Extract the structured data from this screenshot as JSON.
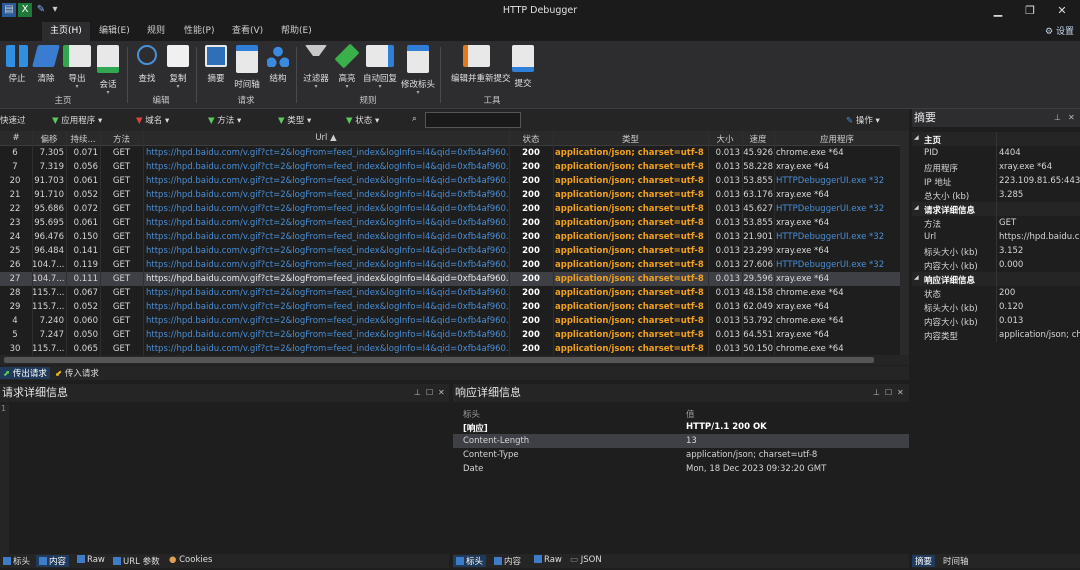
{
  "window": {
    "title": "HTTP Debugger",
    "settings": "设置"
  },
  "menu": [
    "主页(H)",
    "编辑(E)",
    "规则",
    "性能(P)",
    "查看(V)",
    "帮助(E)"
  ],
  "ribbon": {
    "buttons": [
      "停止",
      "清除",
      "导出",
      "会话",
      "查找",
      "复制",
      "摘要",
      "时间轴",
      "结构",
      "过滤器",
      "高亮",
      "自动回复",
      "修改标头",
      "编辑并重新提交",
      "提交"
    ],
    "groups": [
      "主页",
      "编辑",
      "请求",
      "规则",
      "工具"
    ]
  },
  "filterbar": {
    "quick": "快速过",
    "app": "应用程序",
    "domain": "域名",
    "method": "方法",
    "type": "类型",
    "status": "状态",
    "ops": "操作"
  },
  "grid": {
    "columns": [
      "#",
      "偏移",
      "持续...",
      "方法",
      "Url",
      "状态",
      "类型",
      "大小",
      "速度",
      "应用程序"
    ],
    "rows": [
      [
        "6",
        "7.305",
        "0.071",
        "GET",
        "https://hpd.baidu.com/v.gif?ct=2&logFrom=feed_index&logInfo=l4&qid=0xfb4af960...",
        "200",
        "application/json; charset=utf-8",
        "0.013",
        "45.926",
        "chrome.exe *64"
      ],
      [
        "7",
        "7.319",
        "0.056",
        "GET",
        "https://hpd.baidu.com/v.gif?ct=2&logFrom=feed_index&logInfo=l4&qid=0xfb4af960...",
        "200",
        "application/json; charset=utf-8",
        "0.013",
        "58.228",
        "xray.exe *64"
      ],
      [
        "20",
        "91.703",
        "0.061",
        "GET",
        "https://hpd.baidu.com/v.gif?ct=2&logFrom=feed_index&logInfo=l4&qid=0xfb4af960...",
        "200",
        "application/json; charset=utf-8",
        "0.013",
        "53.855",
        "HTTPDebuggerUI.exe *32"
      ],
      [
        "21",
        "91.710",
        "0.052",
        "GET",
        "https://hpd.baidu.com/v.gif?ct=2&logFrom=feed_index&logInfo=l4&qid=0xfb4af960...",
        "200",
        "application/json; charset=utf-8",
        "0.013",
        "63.176",
        "xray.exe *64"
      ],
      [
        "22",
        "95.686",
        "0.072",
        "GET",
        "https://hpd.baidu.com/v.gif?ct=2&logFrom=feed_index&logInfo=l4&qid=0xfb4af960...",
        "200",
        "application/json; charset=utf-8",
        "0.013",
        "45.627",
        "HTTPDebuggerUI.exe *32"
      ],
      [
        "23",
        "95.695",
        "0.061",
        "GET",
        "https://hpd.baidu.com/v.gif?ct=2&logFrom=feed_index&logInfo=l4&qid=0xfb4af960...",
        "200",
        "application/json; charset=utf-8",
        "0.013",
        "53.855",
        "xray.exe *64"
      ],
      [
        "24",
        "96.476",
        "0.150",
        "GET",
        "https://hpd.baidu.com/v.gif?ct=2&logFrom=feed_index&logInfo=l4&qid=0xfb4af960...",
        "200",
        "application/json; charset=utf-8",
        "0.013",
        "21.901",
        "HTTPDebuggerUI.exe *32"
      ],
      [
        "25",
        "96.484",
        "0.141",
        "GET",
        "https://hpd.baidu.com/v.gif?ct=2&logFrom=feed_index&logInfo=l4&qid=0xfb4af960...",
        "200",
        "application/json; charset=utf-8",
        "0.013",
        "23.299",
        "xray.exe *64"
      ],
      [
        "26",
        "104.7...",
        "0.119",
        "GET",
        "https://hpd.baidu.com/v.gif?ct=2&logFrom=feed_index&logInfo=l4&qid=0xfb4af960...",
        "200",
        "application/json; charset=utf-8",
        "0.013",
        "27.606",
        "HTTPDebuggerUI.exe *32"
      ],
      [
        "27",
        "104.7...",
        "0.111",
        "GET",
        "https://hpd.baidu.com/v.gif?ct=2&logFrom=feed_index&logInfo=l4&qid=0xfb4af960...",
        "200",
        "application/json; charset=utf-8",
        "0.013",
        "29.596",
        "xray.exe *64"
      ],
      [
        "28",
        "115.7...",
        "0.067",
        "GET",
        "https://hpd.baidu.com/v.gif?ct=2&logFrom=feed_index&logInfo=l4&qid=0xfb4af960...",
        "200",
        "application/json; charset=utf-8",
        "0.013",
        "48.158",
        "chrome.exe *64"
      ],
      [
        "29",
        "115.7...",
        "0.052",
        "GET",
        "https://hpd.baidu.com/v.gif?ct=2&logFrom=feed_index&logInfo=l4&qid=0xfb4af960...",
        "200",
        "application/json; charset=utf-8",
        "0.013",
        "62.049",
        "xray.exe *64"
      ],
      [
        "4",
        "7.240",
        "0.060",
        "GET",
        "https://hpd.baidu.com/v.gif?ct=2&logFrom=feed_index&logInfo=l4&qid=0xfb4af960...",
        "200",
        "application/json; charset=utf-8",
        "0.013",
        "53.792",
        "chrome.exe *64"
      ],
      [
        "5",
        "7.247",
        "0.050",
        "GET",
        "https://hpd.baidu.com/v.gif?ct=2&logFrom=feed_index&logInfo=l4&qid=0xfb4af960...",
        "200",
        "application/json; charset=utf-8",
        "0.013",
        "64.551",
        "xray.exe *64"
      ],
      [
        "30",
        "115.7...",
        "0.065",
        "GET",
        "https://hpd.baidu.com/v.gif?ct=2&logFrom=feed_index&logInfo=l4&qid=0xfb4af960...",
        "200",
        "application/json; charset=utf-8",
        "0.013",
        "50.150",
        "chrome.exe *64"
      ]
    ],
    "selected_row": "27"
  },
  "grid_tabs": [
    "传出请求",
    "传入请求"
  ],
  "request_panel": {
    "title": "请求详细信息",
    "line": "1",
    "tabs": [
      "标头",
      "内容",
      "Raw",
      "URL 参数",
      "Cookies"
    ]
  },
  "response_panel": {
    "title": "响应详细信息",
    "headers": [
      "标头",
      "值"
    ],
    "rows": [
      [
        "[响应]",
        "HTTP/1.1 200 OK"
      ],
      [
        "Content-Length",
        "13"
      ],
      [
        "Content-Type",
        "application/json; charset=utf-8"
      ],
      [
        "Date",
        "Mon, 18 Dec 2023 09:32:20 GMT"
      ]
    ],
    "tabs": [
      "标头",
      "内容",
      "Raw",
      "JSON"
    ]
  },
  "summary": {
    "title": "摘要",
    "sections": [
      {
        "name": "主页",
        "rows": [
          [
            "PID",
            "4404"
          ],
          [
            "应用程序",
            "xray.exe *64"
          ],
          [
            "IP 地址",
            "223.109.81.65:443"
          ],
          [
            "总大小 (kb)",
            "3.285"
          ]
        ]
      },
      {
        "name": "请求详细信息",
        "rows": [
          [
            "方法",
            "GET"
          ],
          [
            "Url",
            "https://hpd.baidu.co"
          ],
          [
            "标头大小 (kb)",
            "3.152"
          ],
          [
            "内容大小 (kb)",
            "0.000"
          ]
        ]
      },
      {
        "name": "响应详细信息",
        "rows": [
          [
            "状态",
            "200"
          ],
          [
            "标头大小 (kb)",
            "0.120"
          ],
          [
            "内容大小 (kb)",
            "0.013"
          ],
          [
            "内容类型",
            "application/json; ch"
          ]
        ]
      }
    ],
    "tabs": [
      "摘要",
      "时间轴"
    ]
  }
}
